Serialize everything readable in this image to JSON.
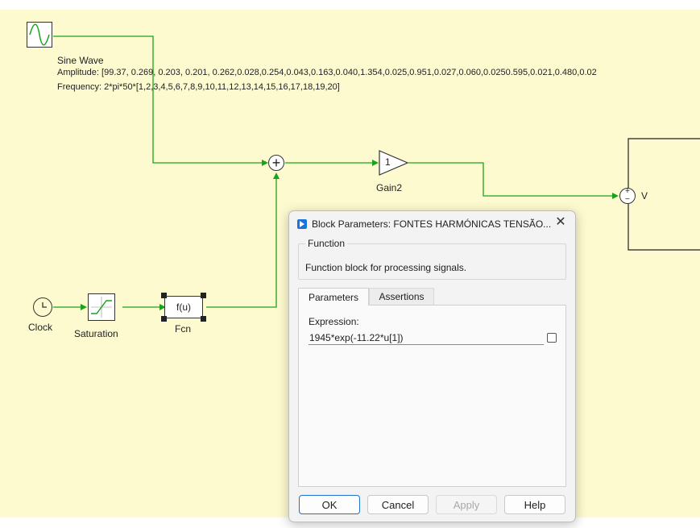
{
  "diagram": {
    "sine_wave": {
      "name": "Sine Wave",
      "amplitude_line": "Amplitude: [99.37, 0.269, 0.203, 0.201, 0.262,0.028,0.254,0.043,0.163,0.040,1.354,0.025,0.951,0.027,0.060,0.0250.595,0.021,0.480,0.02",
      "frequency_line": "Frequency: 2*pi*50*[1,2,3,4,5,6,7,8,9,10,11,12,13,14,15,16,17,18,19,20]"
    },
    "sum_symbol": "+",
    "gain": {
      "value": "1",
      "name": "Gain2"
    },
    "voltage_source": {
      "label": "V",
      "plus": "+",
      "minus": "−"
    },
    "clock": {
      "name": "Clock"
    },
    "saturation": {
      "name": "Saturation"
    },
    "fcn": {
      "expr": "f(u)",
      "name": "Fcn"
    },
    "wire_color": "#1aa31a",
    "canvas_color": "#fdfad0"
  },
  "dialog": {
    "title": "Block Parameters: FONTES HARMÓNICAS TENSÃO...",
    "close_symbol": "✕",
    "group_title": "Function",
    "group_description": "Function block for processing signals.",
    "tabs": [
      {
        "label": "Parameters",
        "active": true
      },
      {
        "label": "Assertions",
        "active": false
      }
    ],
    "expression_label": "Expression:",
    "expression_value": "1945*exp(-11.22*u[1])",
    "buttons": {
      "ok": "OK",
      "cancel": "Cancel",
      "apply": "Apply",
      "help": "Help"
    }
  }
}
